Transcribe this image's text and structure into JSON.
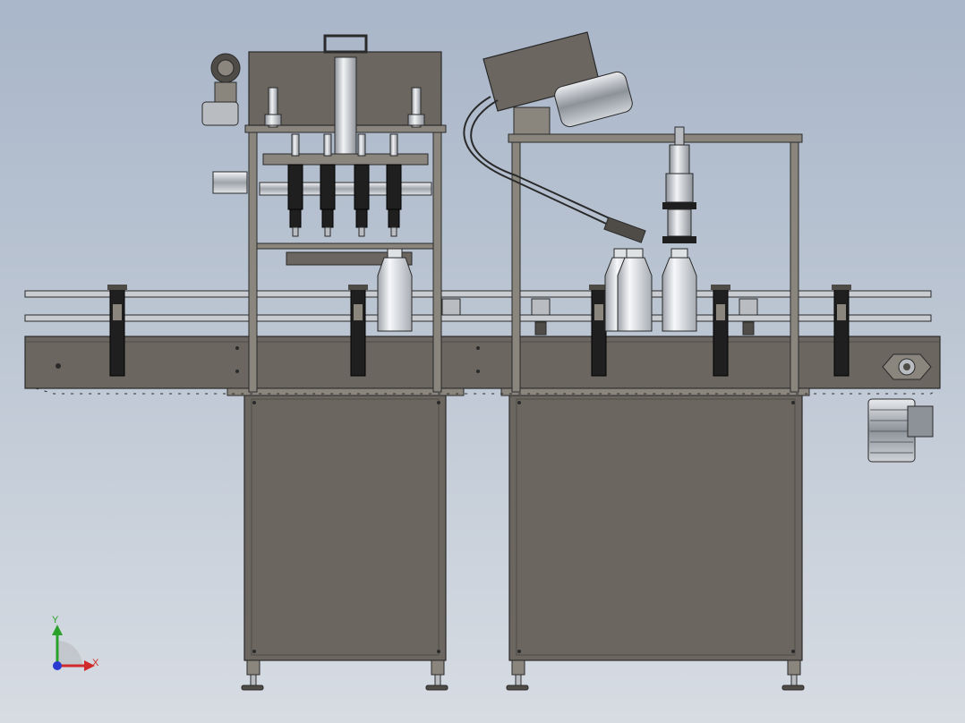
{
  "view": {
    "background_top": "#a9b6c9",
    "background_bottom": "#d7dce3"
  },
  "colors": {
    "frame": "#6b6760",
    "frame_dark": "#4f4c47",
    "frame_light": "#8a867e",
    "outline": "#2a2a2a",
    "steel": "#b9bcc0",
    "chrome": "#dfe2e5",
    "bottle": "#e6e8ec",
    "black_part": "#1f1f1f"
  },
  "axis_triad": {
    "x_label": "X",
    "y_label": "Y",
    "x_color": "#d12a2a",
    "y_color": "#2aa12a",
    "z_color": "#2a3ad1"
  }
}
